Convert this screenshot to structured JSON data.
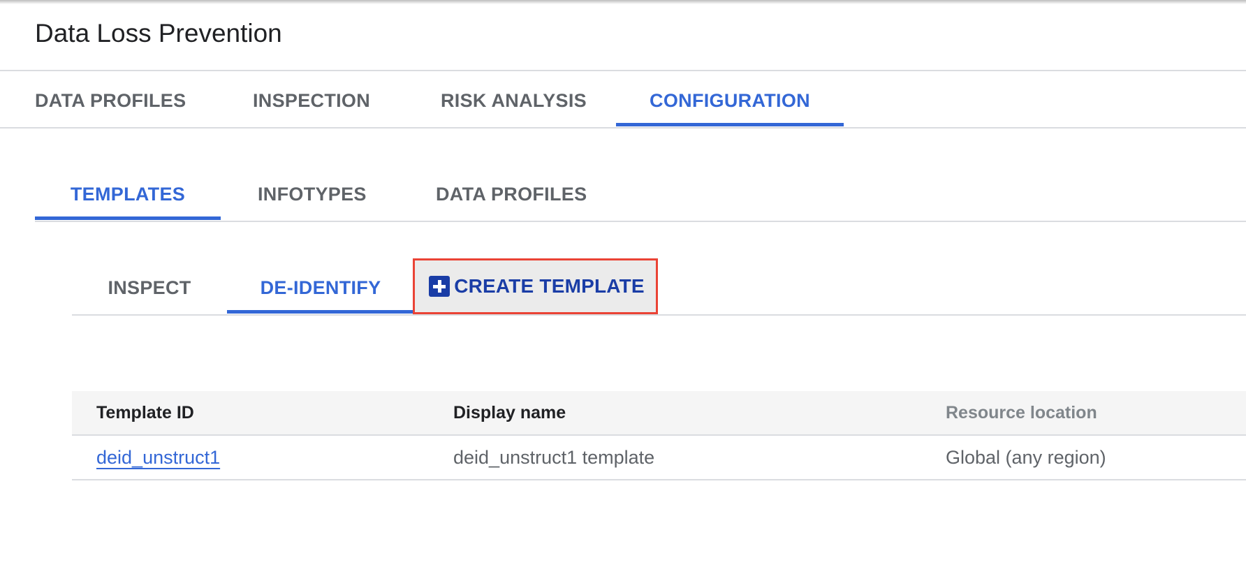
{
  "header": {
    "title": "Data Loss Prevention"
  },
  "main_tabs": [
    {
      "label": "DATA PROFILES",
      "active": false
    },
    {
      "label": "INSPECTION",
      "active": false
    },
    {
      "label": "RISK ANALYSIS",
      "active": false
    },
    {
      "label": "CONFIGURATION",
      "active": true
    }
  ],
  "config_tabs": [
    {
      "label": "TEMPLATES",
      "active": true
    },
    {
      "label": "INFOTYPES",
      "active": false
    },
    {
      "label": "DATA PROFILES",
      "active": false
    }
  ],
  "template_tabs": [
    {
      "label": "INSPECT",
      "active": false
    },
    {
      "label": "DE-IDENTIFY",
      "active": true
    }
  ],
  "create_button": {
    "label": "CREATE TEMPLATE",
    "icon": "plus-box-icon"
  },
  "table": {
    "columns": [
      "Template ID",
      "Display name",
      "Resource location"
    ],
    "rows": [
      {
        "template_id": "deid_unstruct1",
        "display_name": "deid_unstruct1 template",
        "location": "Global (any region)"
      }
    ]
  },
  "colors": {
    "accent": "#3367d6",
    "button_text": "#1a3da6",
    "highlight_border": "#ea4335"
  }
}
